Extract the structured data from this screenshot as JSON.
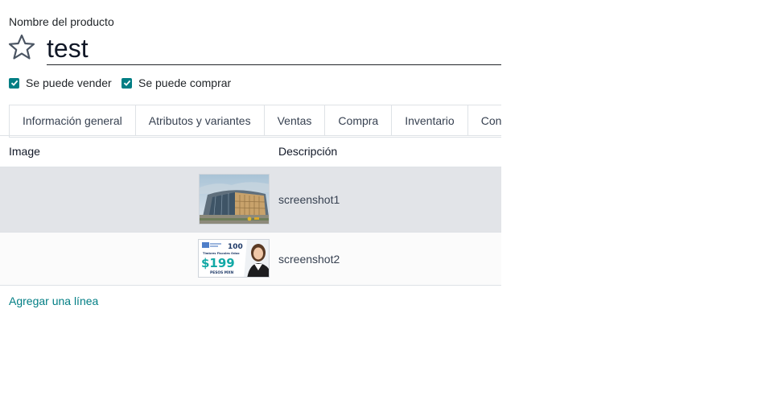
{
  "product": {
    "field_label": "Nombre del producto",
    "name": "test",
    "favorite_icon": "star-outline-icon"
  },
  "options": {
    "sale_ok": {
      "label": "Se puede vender",
      "checked": true
    },
    "purchase_ok": {
      "label": "Se puede comprar",
      "checked": true
    }
  },
  "tabs": [
    {
      "label": "Información general"
    },
    {
      "label": "Atributos y variantes"
    },
    {
      "label": "Ventas"
    },
    {
      "label": "Compra"
    },
    {
      "label": "Inventario"
    },
    {
      "label": "Cont"
    }
  ],
  "table": {
    "headers": {
      "image": "Image",
      "description": "Descripción"
    },
    "rows": [
      {
        "description": "screenshot1",
        "image": {
          "icon": "building-photo-thumbnail"
        }
      },
      {
        "description": "screenshot2",
        "image": {
          "icon": "promo-banner-thumbnail",
          "text_top": "100",
          "text_sub": "Timbres Fiscales Odoo",
          "price": "$199",
          "currency": "PESOS MXN"
        }
      }
    ],
    "add_line": "Agregar una línea"
  },
  "colors": {
    "accent": "#017e84",
    "selected_row": "#e2e4e8",
    "border": "#dee2e6"
  }
}
